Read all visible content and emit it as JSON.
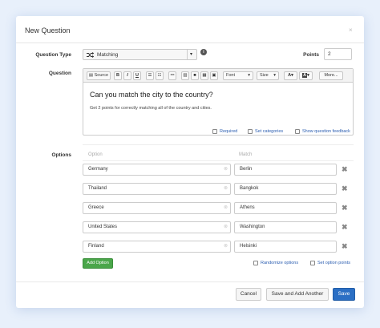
{
  "dialog": {
    "title": "New Question",
    "close": "×"
  },
  "labels": {
    "question_type": "Question Type",
    "question": "Question",
    "points": "Points",
    "options": "Options"
  },
  "question_type": {
    "value": "Matching",
    "icon": "shuffle-icon"
  },
  "points": {
    "value": "2"
  },
  "toolbar": {
    "source": "Source",
    "bold": "B",
    "italic": "I",
    "underline": "U",
    "font": "Font",
    "size": "Size",
    "text_color": "A",
    "bg_color": "A",
    "more": "More..."
  },
  "question": {
    "title": "Can you match the city to the country?",
    "description": "Get 2 points for correctly matching all of the country and cities."
  },
  "question_checks": [
    "Required",
    "Set categories",
    "Show question feedback"
  ],
  "options_columns": {
    "option": "Option",
    "match": "Match"
  },
  "pairs": [
    {
      "option": "Germany",
      "match": "Berlin"
    },
    {
      "option": "Thailand",
      "match": "Bangkok"
    },
    {
      "option": "Greece",
      "match": "Athens"
    },
    {
      "option": "United States",
      "match": "Washington"
    },
    {
      "option": "Finland",
      "match": "Helsinki"
    }
  ],
  "add_option": "Add Option",
  "option_checks": [
    "Randomize options",
    "Set option points"
  ],
  "footer": {
    "cancel": "Cancel",
    "save_add": "Save and Add Another",
    "save": "Save"
  },
  "colors": {
    "primary": "#2b6fc4",
    "success": "#4aa64a",
    "link": "#2a5db0"
  }
}
